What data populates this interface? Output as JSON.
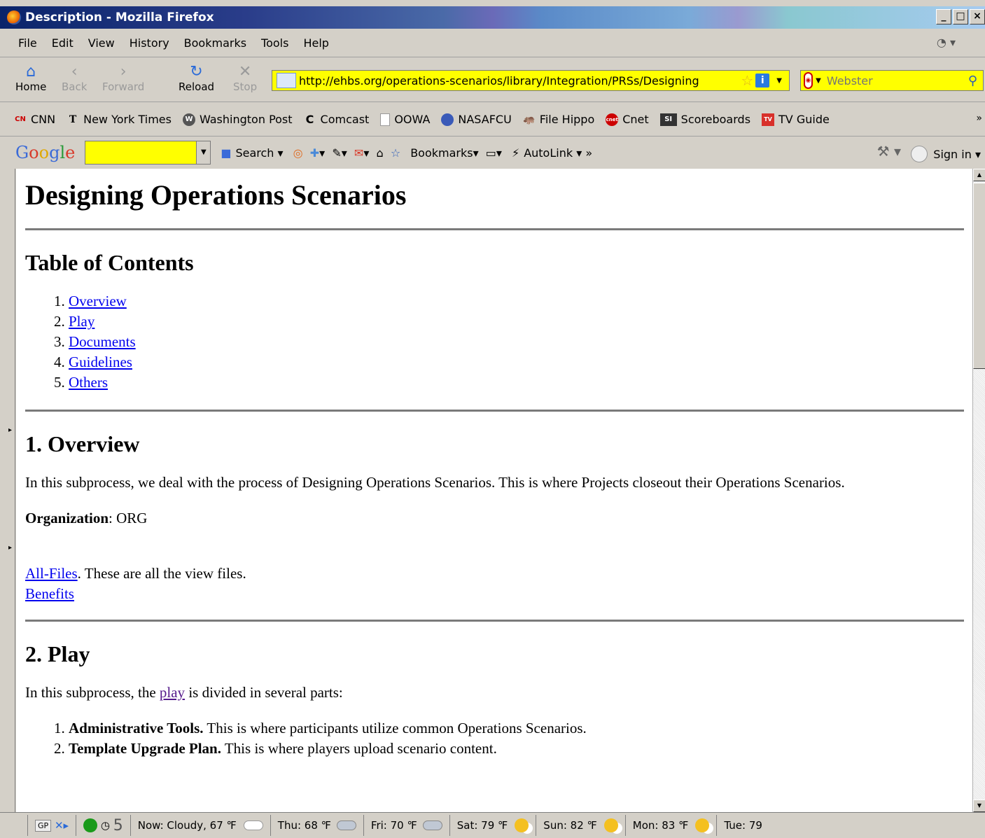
{
  "window": {
    "title": "Description - Mozilla Firefox",
    "controls": [
      "_",
      "□",
      "×"
    ]
  },
  "menu": [
    "File",
    "Edit",
    "View",
    "History",
    "Bookmarks",
    "Tools",
    "Help"
  ],
  "nav": {
    "home": "Home",
    "back": "Back",
    "forward": "Forward",
    "reload": "Reload",
    "stop": "Stop",
    "url": "http://ehbs.org/operations-scenarios/library/Integration/PRSs/Designing",
    "search_placeholder": "Webster"
  },
  "bookmarks": [
    {
      "label": "CNN",
      "icon": "cnn-icon",
      "badge": "CNN"
    },
    {
      "label": "New York Times",
      "icon": "nyt-icon",
      "badge": "T"
    },
    {
      "label": "Washington Post",
      "icon": "wapo-icon",
      "badge": "W"
    },
    {
      "label": "Comcast",
      "icon": "comcast-icon",
      "badge": "C"
    },
    {
      "label": "OOWA",
      "icon": "page-icon",
      "badge": ""
    },
    {
      "label": "NASAFCU",
      "icon": "nasafcu-icon",
      "badge": ""
    },
    {
      "label": "File Hippo",
      "icon": "filehippo-icon",
      "badge": ""
    },
    {
      "label": "Cnet",
      "icon": "cnet-icon",
      "badge": "cnet"
    },
    {
      "label": "Scoreboards",
      "icon": "si-icon",
      "badge": "SI"
    },
    {
      "label": "TV Guide",
      "icon": "tvguide-icon",
      "badge": "TV"
    }
  ],
  "google_toolbar": {
    "logo": [
      "G",
      "o",
      "o",
      "g",
      "l",
      "e"
    ],
    "search": "Search",
    "bookmarks": "Bookmarks",
    "autolink": "AutoLink",
    "signin": "Sign in"
  },
  "page": {
    "title": "Designing Operations Scenarios",
    "toc_heading": "Table of Contents",
    "toc": [
      "Overview",
      "Play",
      "Documents",
      "Guidelines",
      "Others"
    ],
    "overview": {
      "heading": "1. Overview",
      "text": "In this subprocess, we deal with the process of Designing Operations Scenarios. This is where Projects closeout their Operations Scenarios.",
      "org_label": "Organization",
      "org_value": ": ORG",
      "allfiles_link": "All-Files",
      "allfiles_text": ". These are all the view files.",
      "benefits_link": "Benefits"
    },
    "play": {
      "heading": "2. Play",
      "text_before": "In this subprocess, the ",
      "link": "play",
      "text_after": " is divided in several parts:",
      "items": [
        {
          "bold": "Administrative Tools.",
          "text": " This is where participants utilize common Operations Scenarios."
        },
        {
          "bold": "Template Upgrade Plan.",
          "text": " This is where players upload scenario content."
        }
      ]
    }
  },
  "status": {
    "gp": "GP",
    "count": "5",
    "weather": [
      {
        "label": "Now: Cloudy, 67 ℉",
        "icon": "cloud"
      },
      {
        "label": "Thu: 68 ℉",
        "icon": "rain"
      },
      {
        "label": "Fri: 70 ℉",
        "icon": "rain"
      },
      {
        "label": "Sat: 79 ℉",
        "icon": "sun"
      },
      {
        "label": "Sun: 82 ℉",
        "icon": "sun"
      },
      {
        "label": "Mon: 83 ℉",
        "icon": "sun"
      },
      {
        "label": "Tue: 79",
        "icon": "none"
      }
    ]
  }
}
